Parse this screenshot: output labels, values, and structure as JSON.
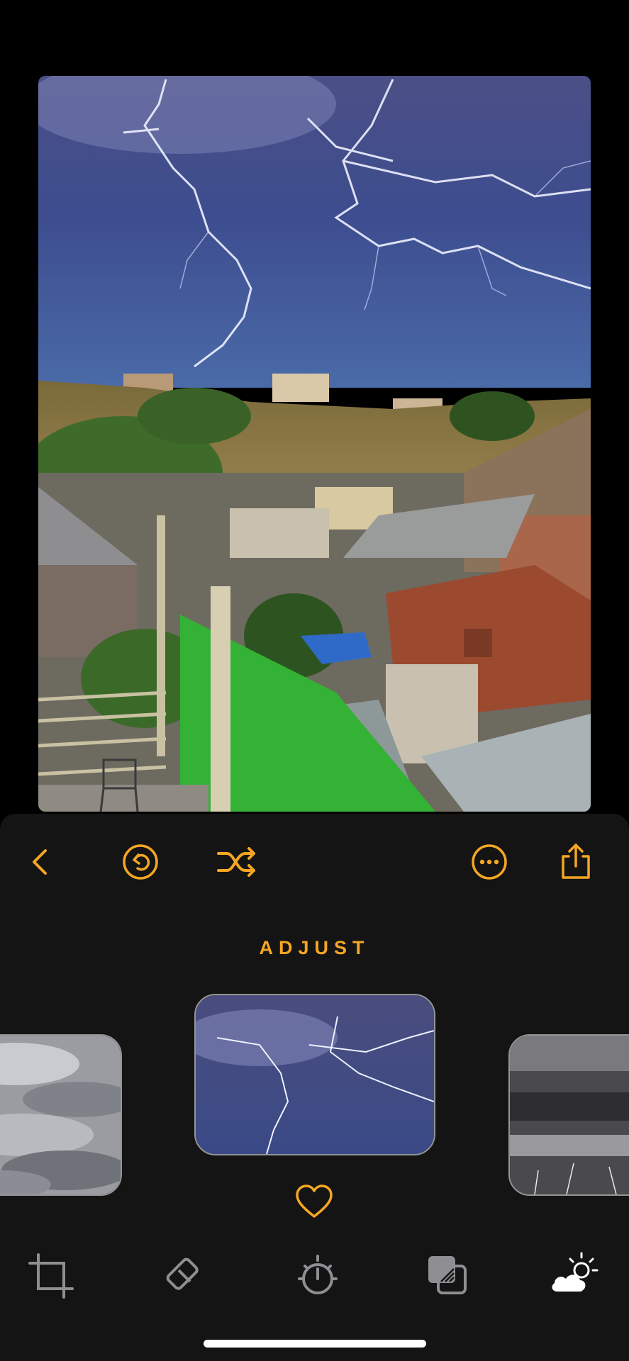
{
  "editor": {
    "section_title": "ADJUST"
  },
  "toolbar": {
    "back_icon": "chevron-left-icon",
    "revert_icon": "revert-icon",
    "shuffle_icon": "shuffle-icon",
    "more_icon": "ellipsis-circle-icon",
    "share_icon": "share-icon"
  },
  "sky_presets": [
    {
      "name": "overcast-clouds",
      "selected": false
    },
    {
      "name": "lightning-storm",
      "selected": true
    },
    {
      "name": "dark-storm",
      "selected": false
    }
  ],
  "favorite_icon": "heart-icon",
  "tabs": [
    {
      "icon": "crop-icon",
      "active": false
    },
    {
      "icon": "eraser-icon",
      "active": false
    },
    {
      "icon": "timer-icon",
      "active": false
    },
    {
      "icon": "layers-icon",
      "active": false
    },
    {
      "icon": "sky-weather-icon",
      "active": true
    }
  ],
  "colors": {
    "accent": "#f5a623",
    "panel": "#141414",
    "background": "#000000",
    "inactive_icon": "#8e8e93"
  }
}
